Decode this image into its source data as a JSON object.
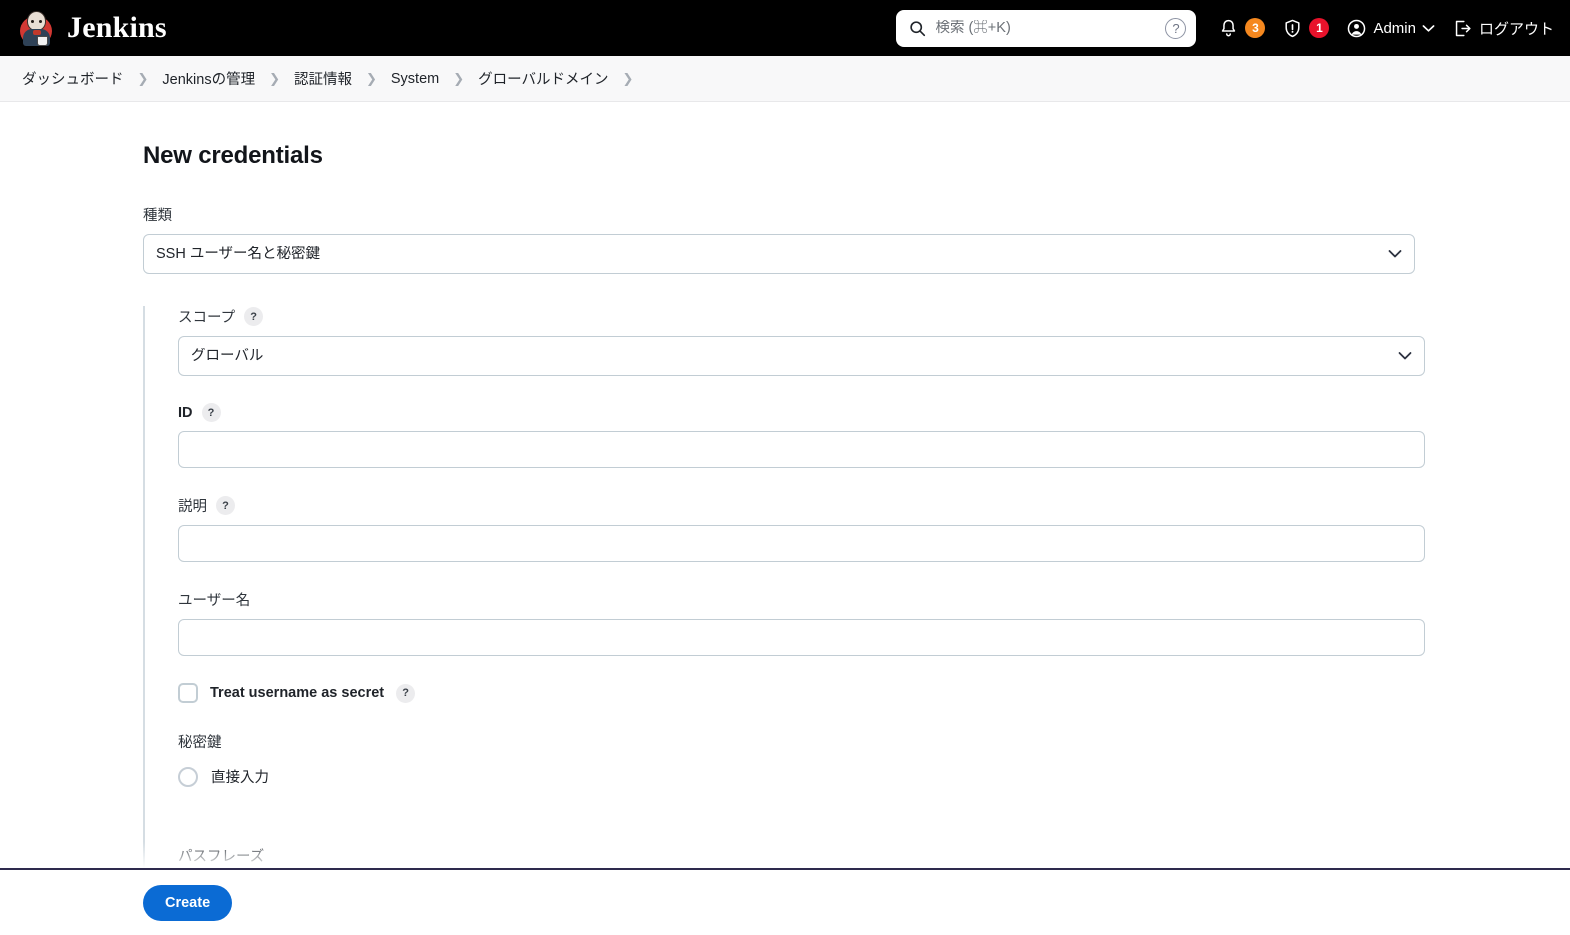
{
  "header": {
    "brand": "Jenkins",
    "brand_logo_icon": "jenkins-butler-logo",
    "search": {
      "placeholder": "検索 (⌘+K)",
      "value": "",
      "search_icon": "search-icon",
      "help_icon": "question-circle-icon"
    },
    "notifications": {
      "icon": "bell-icon",
      "count": "3",
      "color": "#f5881f"
    },
    "security": {
      "icon": "shield-exclamation-icon",
      "count": "1",
      "color": "#e8122b"
    },
    "user": {
      "icon": "user-circle-icon",
      "label": "Admin",
      "chevron_icon": "chevron-down-icon"
    },
    "logout": {
      "icon": "logout-icon",
      "label": "ログアウト"
    }
  },
  "breadcrumbs": [
    {
      "label": "ダッシュボード"
    },
    {
      "label": "Jenkinsの管理"
    },
    {
      "label": "認証情報"
    },
    {
      "label": "System"
    },
    {
      "label": "グローバルドメイン"
    }
  ],
  "breadcrumb_separator": "❯",
  "main": {
    "title": "New credentials",
    "kind": {
      "label": "種類",
      "value": "SSH ユーザー名と秘密鍵",
      "options": [
        "SSH ユーザー名と秘密鍵"
      ]
    },
    "scope": {
      "label": "スコープ",
      "help": "?",
      "value": "グローバル",
      "options": [
        "グローバル"
      ]
    },
    "id": {
      "label": "ID",
      "help": "?",
      "value": "",
      "placeholder": ""
    },
    "description": {
      "label": "説明",
      "help": "?",
      "value": "",
      "placeholder": ""
    },
    "username": {
      "label": "ユーザー名",
      "value": "",
      "placeholder": ""
    },
    "treat_secret": {
      "label": "Treat username as secret",
      "help": "?",
      "checked": false
    },
    "private_key": {
      "label": "秘密鍵",
      "radio_label": "直接入力",
      "selected": false
    },
    "passphrase": {
      "label": "パスフレーズ",
      "value": "",
      "placeholder": ""
    }
  },
  "footer": {
    "create_label": "Create",
    "accent_color": "#0b6bd4"
  }
}
